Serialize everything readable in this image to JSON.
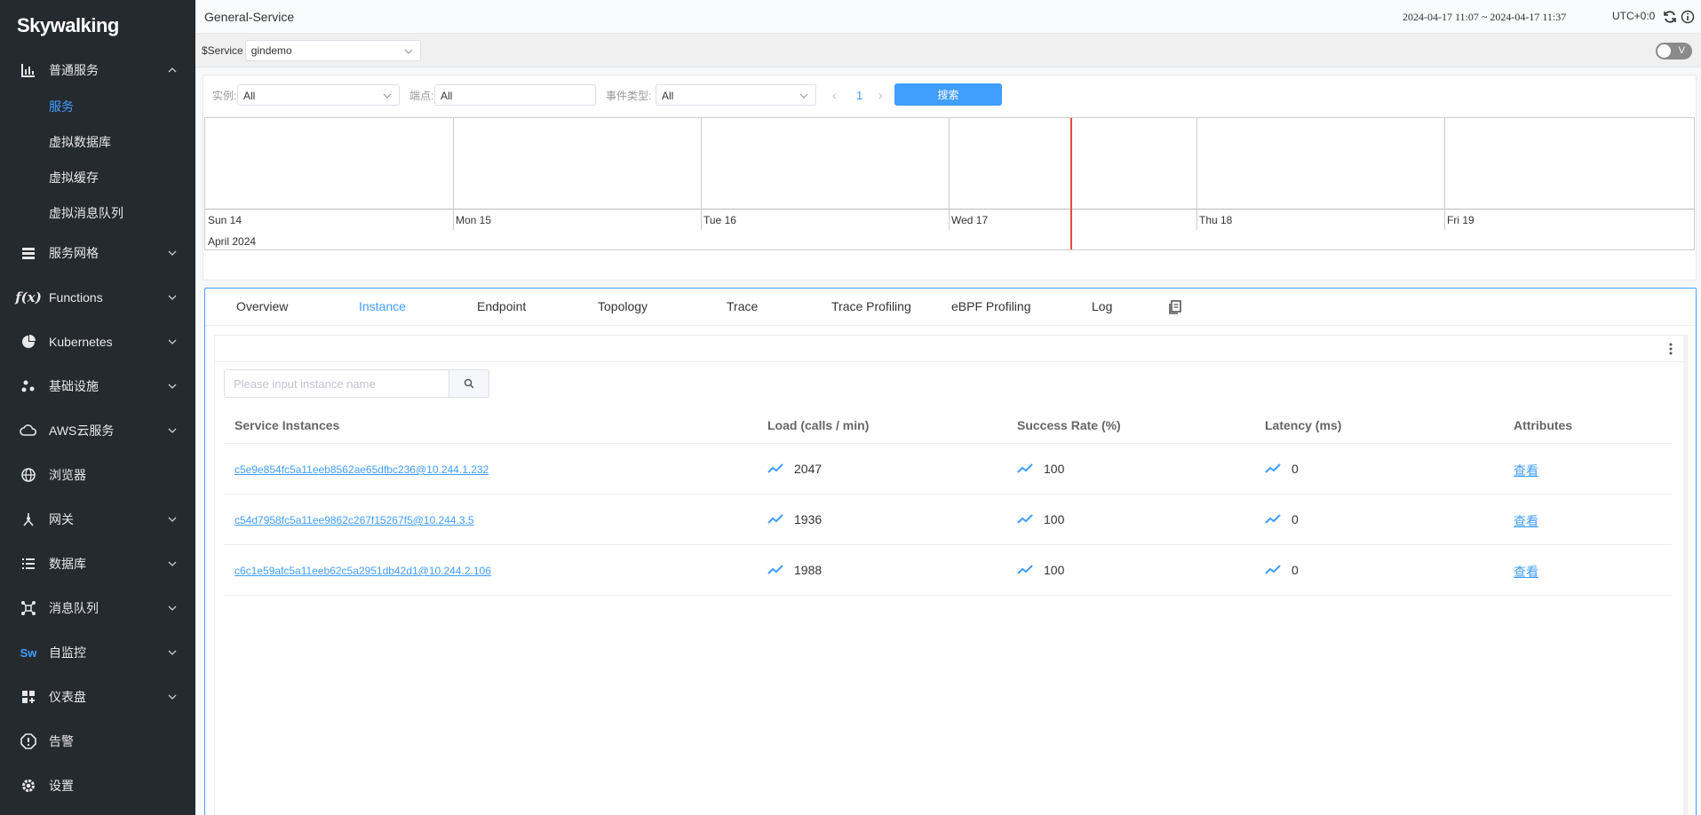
{
  "sidebar": {
    "logo": "Skywalking",
    "items": [
      {
        "label": "普通服务",
        "icon": "bar-chart-icon",
        "expanded": true,
        "children": [
          "服务",
          "虚拟数据库",
          "虚拟缓存",
          "虚拟消息队列"
        ],
        "active_child": "服务"
      },
      {
        "label": "服务网格",
        "icon": "layers-icon"
      },
      {
        "label": "Functions",
        "icon": "function-icon"
      },
      {
        "label": "Kubernetes",
        "icon": "pie-icon"
      },
      {
        "label": "基础设施",
        "icon": "nodes-icon"
      },
      {
        "label": "AWS云服务",
        "icon": "cloud-icon"
      },
      {
        "label": "浏览器",
        "icon": "globe-icon"
      },
      {
        "label": "网关",
        "icon": "gateway-icon"
      },
      {
        "label": "数据库",
        "icon": "database-icon"
      },
      {
        "label": "消息队列",
        "icon": "network-icon"
      },
      {
        "label": "自监控",
        "icon": "sw-icon"
      },
      {
        "label": "仪表盘",
        "icon": "dashboard-icon"
      },
      {
        "label": "告警",
        "icon": "alarm-icon"
      },
      {
        "label": "设置",
        "icon": "settings-icon"
      }
    ]
  },
  "header": {
    "title": "General-Service",
    "time_range": "2024-04-17 11:07 ~ 2024-04-17 11:37",
    "timezone": "UTC+0:0"
  },
  "service_bar": {
    "label": "$Service",
    "selected": "gindemo",
    "toggle_label": "V"
  },
  "event_filters": {
    "instance_label": "实例:",
    "instance_value": "All",
    "endpoint_label": "端点:",
    "endpoint_value": "All",
    "event_type_label": "事件类型:",
    "event_type_value": "All",
    "page": "1",
    "search_button": "搜索"
  },
  "timeline": {
    "days": [
      "Sun 14",
      "Mon 15",
      "Tue 16",
      "Wed 17",
      "Thu 18",
      "Fri 19"
    ],
    "month": "April 2024"
  },
  "tabs": [
    "Overview",
    "Instance",
    "Endpoint",
    "Topology",
    "Trace",
    "Trace Profiling",
    "eBPF Profiling",
    "Log"
  ],
  "active_tab": "Instance",
  "instance_search": {
    "placeholder": "Please input instance name"
  },
  "table": {
    "headers": [
      "Service Instances",
      "Load (calls / min)",
      "Success Rate (%)",
      "Latency (ms)",
      "Attributes"
    ],
    "rows": [
      {
        "instance": "c5e9e854fc5a11eeb8562ae65dfbc236@10.244.1.232",
        "load": "2047",
        "success": "100",
        "latency": "0",
        "attr": "查看"
      },
      {
        "instance": "c54d7958fc5a11ee9862c267f15267f5@10.244.3.5",
        "load": "1936",
        "success": "100",
        "latency": "0",
        "attr": "查看"
      },
      {
        "instance": "c6c1e59afc5a11eeb62c5a2951db42d1@10.244.2.106",
        "load": "1988",
        "success": "100",
        "latency": "0",
        "attr": "查看"
      }
    ]
  },
  "colors": {
    "sidebar_bg": "#252a2f",
    "accent": "#409eff",
    "now_line": "#e74c3c"
  }
}
